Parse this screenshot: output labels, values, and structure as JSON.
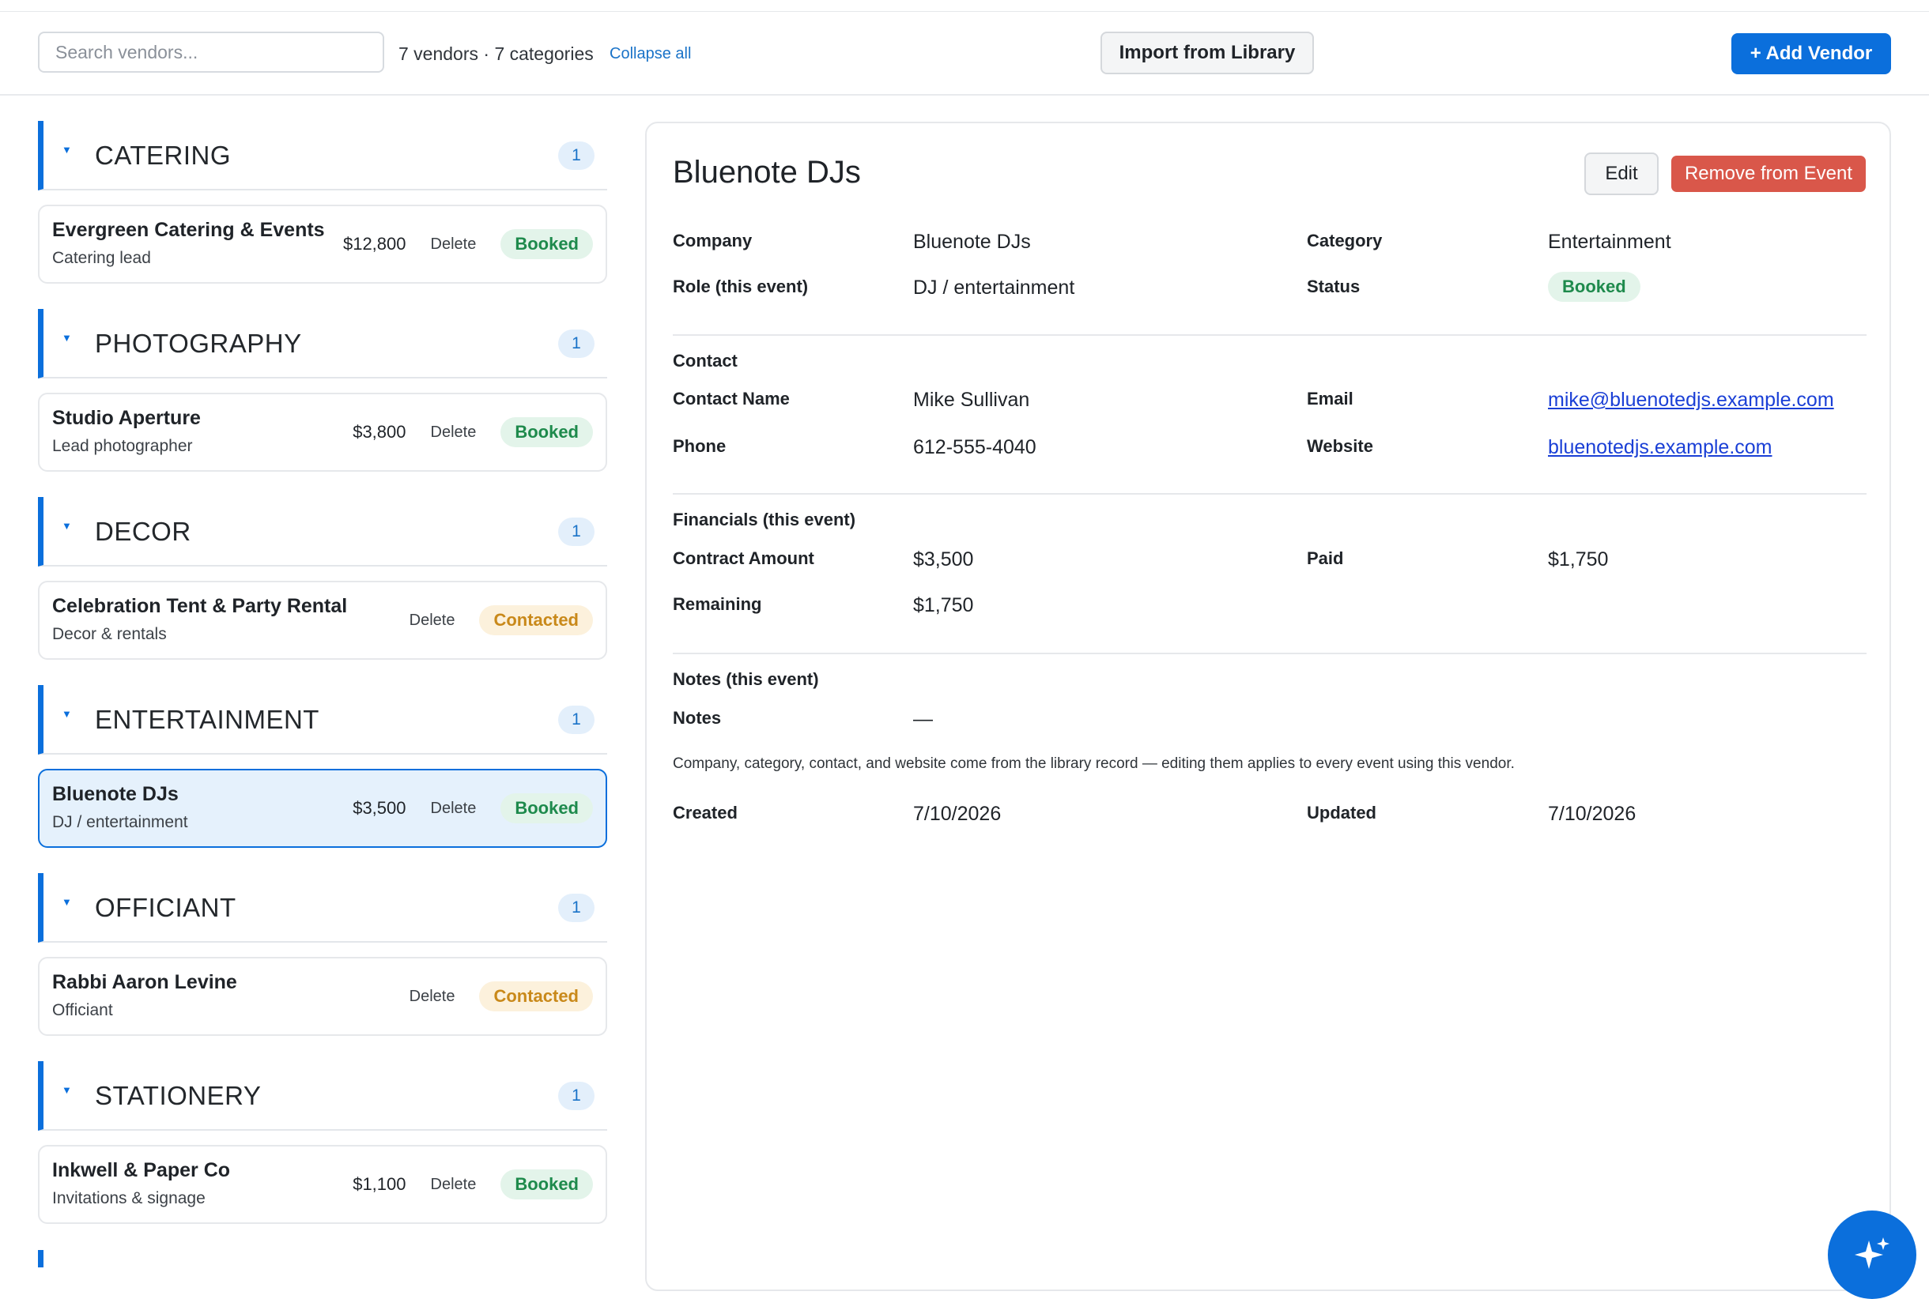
{
  "toolbar": {
    "search_placeholder": "Search vendors...",
    "summary": "7 vendors · 7 categories",
    "collapse_all": "Collapse all",
    "import_label": "Import from Library",
    "add_label": "+ Add Vendor"
  },
  "categories": [
    {
      "name": "CATERING",
      "count": "1",
      "vendor": {
        "name": "Evergreen Catering & Events",
        "role": "Catering lead",
        "amount": "$12,800",
        "delete": "Delete",
        "status": "Booked"
      }
    },
    {
      "name": "PHOTOGRAPHY",
      "count": "1",
      "vendor": {
        "name": "Studio Aperture",
        "role": "Lead photographer",
        "amount": "$3,800",
        "delete": "Delete",
        "status": "Booked"
      }
    },
    {
      "name": "DECOR",
      "count": "1",
      "vendor": {
        "name": "Celebration Tent & Party Rental",
        "role": "Decor & rentals",
        "amount": "",
        "delete": "Delete",
        "status": "Contacted"
      }
    },
    {
      "name": "ENTERTAINMENT",
      "count": "1",
      "vendor": {
        "name": "Bluenote DJs",
        "role": "DJ / entertainment",
        "amount": "$3,500",
        "delete": "Delete",
        "status": "Booked"
      }
    },
    {
      "name": "OFFICIANT",
      "count": "1",
      "vendor": {
        "name": "Rabbi Aaron Levine",
        "role": "Officiant",
        "amount": "",
        "delete": "Delete",
        "status": "Contacted"
      }
    },
    {
      "name": "STATIONERY",
      "count": "1",
      "vendor": {
        "name": "Inkwell & Paper Co",
        "role": "Invitations & signage",
        "amount": "$1,100",
        "delete": "Delete",
        "status": "Booked"
      }
    }
  ],
  "detail": {
    "title": "Bluenote DJs",
    "edit_label": "Edit",
    "remove_label": "Remove from Event",
    "company_label": "Company",
    "company": "Bluenote DJs",
    "category_label": "Category",
    "category": "Entertainment",
    "role_label": "Role (this event)",
    "role": "DJ / entertainment",
    "status_label": "Status",
    "status": "Booked",
    "contact_section": "Contact",
    "contact_name_label": "Contact Name",
    "contact_name": "Mike Sullivan",
    "email_label": "Email",
    "email": "mike@bluenotedjs.example.com",
    "phone_label": "Phone",
    "phone": "612-555-4040",
    "website_label": "Website",
    "website": "bluenotedjs.example.com",
    "financials_section": "Financials (this event)",
    "contract_label": "Contract Amount",
    "contract": "$3,500",
    "paid_label": "Paid",
    "paid": "$1,750",
    "remaining_label": "Remaining",
    "remaining": "$1,750",
    "notes_section": "Notes (this event)",
    "notes_label": "Notes",
    "notes": "—",
    "library_note": "Company, category, contact, and website come from the library record — editing them applies to every event using this vendor.",
    "created_label": "Created",
    "created": "7/10/2026",
    "updated_label": "Updated",
    "updated": "7/10/2026"
  },
  "colors": {
    "accent": "#0b6fdc",
    "danger": "#d9574a",
    "booked": "#1e8a4c",
    "contacted": "#c9891a"
  },
  "icons": {
    "fab": "sparkle-icon",
    "chevron": "chevron-down-icon"
  }
}
